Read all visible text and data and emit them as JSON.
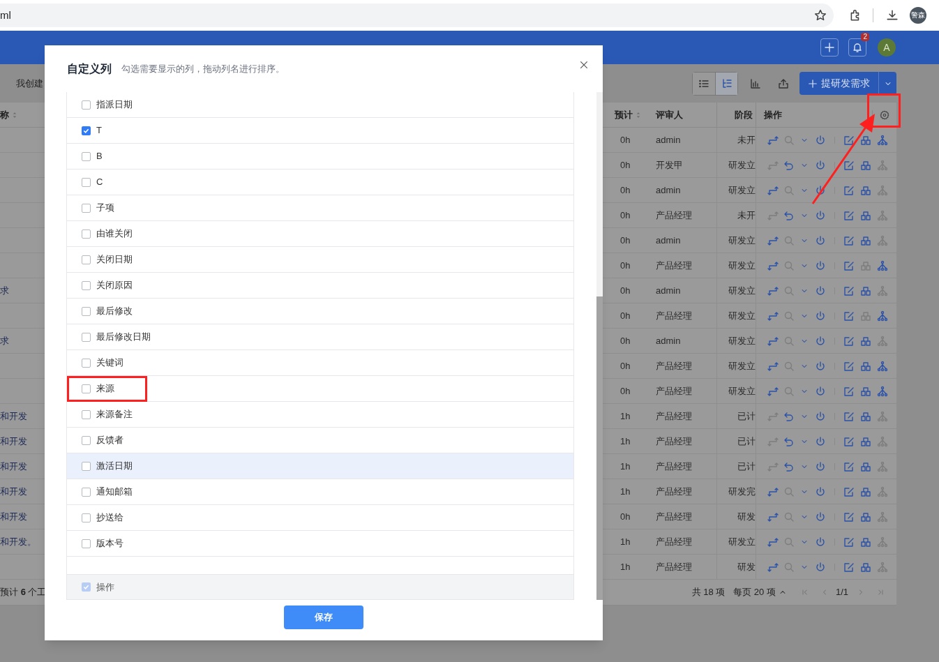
{
  "browser": {
    "address": "ml",
    "profile": "警森"
  },
  "header": {
    "notification_count": "2",
    "avatar": "A"
  },
  "toolbar": {
    "tab_fragment": "我创建",
    "views": [
      {
        "kind": "list",
        "selected": false
      },
      {
        "kind": "tree",
        "selected": true
      }
    ],
    "create_button": "提研发需求"
  },
  "table": {
    "columns": [
      {
        "label": "称",
        "sortable": true
      },
      {
        "label": "预计",
        "sortable": true
      },
      {
        "label": "评审人",
        "sortable": false
      },
      {
        "label": "阶段",
        "sortable": false
      },
      {
        "label": "操作",
        "sortable": false
      }
    ],
    "rows": [
      {
        "estimate": "0h",
        "reviewer": "admin",
        "stage": "未开",
        "change_on": true,
        "kind": "search",
        "split_on": true,
        "tree_on": true
      },
      {
        "estimate": "0h",
        "reviewer": "开发甲",
        "stage": "研发立",
        "change_on": false,
        "kind": "undo",
        "split_on": true,
        "tree_on": false
      },
      {
        "estimate": "0h",
        "reviewer": "admin",
        "stage": "研发立",
        "change_on": true,
        "kind": "search",
        "split_on": true,
        "tree_on": false
      },
      {
        "estimate": "0h",
        "reviewer": "产品经理",
        "stage": "未开",
        "change_on": false,
        "kind": "undo",
        "split_on": true,
        "tree_on": false
      },
      {
        "estimate": "0h",
        "reviewer": "admin",
        "stage": "研发立",
        "change_on": true,
        "kind": "search",
        "split_on": true,
        "tree_on": false
      },
      {
        "estimate": "0h",
        "reviewer": "产品经理",
        "stage": "研发立",
        "change_on": true,
        "kind": "search",
        "split_on": false,
        "tree_on": true
      },
      {
        "name": "求",
        "estimate": "0h",
        "reviewer": "admin",
        "stage": "研发立",
        "change_on": true,
        "kind": "search",
        "split_on": true,
        "tree_on": false
      },
      {
        "estimate": "0h",
        "reviewer": "产品经理",
        "stage": "研发立",
        "change_on": true,
        "kind": "search",
        "split_on": false,
        "tree_on": true
      },
      {
        "name": "求",
        "estimate": "0h",
        "reviewer": "admin",
        "stage": "研发立",
        "change_on": true,
        "kind": "search",
        "split_on": true,
        "tree_on": false
      },
      {
        "estimate": "0h",
        "reviewer": "产品经理",
        "stage": "研发立",
        "change_on": true,
        "kind": "search",
        "split_on": true,
        "tree_on": true
      },
      {
        "estimate": "0h",
        "reviewer": "产品经理",
        "stage": "研发立",
        "change_on": true,
        "kind": "search",
        "split_on": true,
        "tree_on": true
      },
      {
        "name": "和开发",
        "estimate": "1h",
        "reviewer": "产品经理",
        "stage": "已计",
        "change_on": false,
        "kind": "undo",
        "split_on": true,
        "tree_on": false
      },
      {
        "name": "和开发",
        "estimate": "1h",
        "reviewer": "产品经理",
        "stage": "已计",
        "change_on": false,
        "kind": "undo",
        "split_on": true,
        "tree_on": false
      },
      {
        "name": "和开发",
        "estimate": "1h",
        "reviewer": "产品经理",
        "stage": "已计",
        "change_on": false,
        "kind": "undo",
        "split_on": true,
        "tree_on": false
      },
      {
        "name": "和开发",
        "estimate": "1h",
        "reviewer": "产品经理",
        "stage": "研发完",
        "change_on": true,
        "kind": "search",
        "split_on": true,
        "tree_on": false
      },
      {
        "name": "和开发",
        "estimate": "0h",
        "reviewer": "产品经理",
        "stage": "研发",
        "change_on": true,
        "kind": "search",
        "split_on": true,
        "tree_on": false
      },
      {
        "name": "和开发。",
        "estimate": "1h",
        "reviewer": "产品经理",
        "stage": "研发立",
        "change_on": true,
        "kind": "search",
        "split_on": true,
        "tree_on": false
      },
      {
        "estimate": "1h",
        "reviewer": "产品经理",
        "stage": "研发",
        "change_on": true,
        "kind": "search",
        "split_on": true,
        "tree_on": false
      }
    ],
    "footer": {
      "summary": "预计 **6** 个工",
      "total": "共 18 项",
      "per_page": "每页 20 项",
      "page": "1/1"
    }
  },
  "modal": {
    "title": "自定义列",
    "subtitle": "勾选需要显示的列，拖动列名进行排序。",
    "save": "保存",
    "columns": [
      {
        "label": "指派日期",
        "checked": false,
        "disabled": false,
        "highlighted": false
      },
      {
        "label": "T",
        "checked": true,
        "disabled": false,
        "highlighted": false
      },
      {
        "label": "B",
        "checked": false,
        "disabled": false,
        "highlighted": false
      },
      {
        "label": "C",
        "checked": false,
        "disabled": false,
        "highlighted": false
      },
      {
        "label": "子项",
        "checked": false,
        "disabled": false,
        "highlighted": false
      },
      {
        "label": "由谁关闭",
        "checked": false,
        "disabled": false,
        "highlighted": false
      },
      {
        "label": "关闭日期",
        "checked": false,
        "disabled": false,
        "highlighted": false
      },
      {
        "label": "关闭原因",
        "checked": false,
        "disabled": false,
        "highlighted": false
      },
      {
        "label": "最后修改",
        "checked": false,
        "disabled": false,
        "highlighted": false
      },
      {
        "label": "最后修改日期",
        "checked": false,
        "disabled": false,
        "highlighted": false
      },
      {
        "label": "关键词",
        "checked": false,
        "disabled": false,
        "highlighted": false
      },
      {
        "label": "来源",
        "checked": false,
        "disabled": false,
        "highlighted": false
      },
      {
        "label": "来源备注",
        "checked": false,
        "disabled": false,
        "highlighted": false
      },
      {
        "label": "反馈者",
        "checked": false,
        "disabled": false,
        "highlighted": false
      },
      {
        "label": "激活日期",
        "checked": false,
        "disabled": false,
        "highlighted": true
      },
      {
        "label": "通知邮箱",
        "checked": false,
        "disabled": false,
        "highlighted": false
      },
      {
        "label": "抄送给",
        "checked": false,
        "disabled": false,
        "highlighted": false
      },
      {
        "label": "版本号",
        "checked": false,
        "disabled": false,
        "highlighted": false
      },
      {
        "label": "操作",
        "checked": true,
        "disabled": true,
        "highlighted": false
      }
    ]
  }
}
